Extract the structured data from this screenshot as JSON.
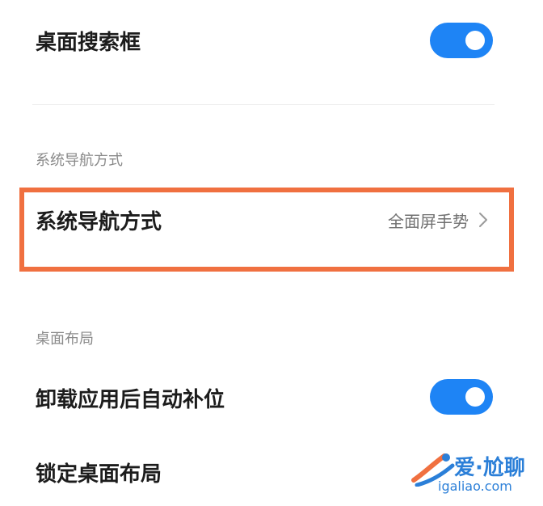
{
  "settings": {
    "search_box": {
      "label": "桌面搜索框",
      "enabled": true
    },
    "navigation_section": {
      "header": "系统导航方式",
      "row_label": "系统导航方式",
      "row_value": "全面屏手势"
    },
    "layout_section": {
      "header": "桌面布局",
      "auto_fill": {
        "label": "卸载应用后自动补位",
        "enabled": true
      },
      "lock_layout": {
        "label": "锁定桌面布局"
      }
    }
  },
  "watermark": {
    "title": "爱·尬聊",
    "url": "igaliao.com"
  },
  "colors": {
    "toggle_on": "#1e84f5",
    "highlight_border": "#f07040",
    "section_header": "#8a8a8a",
    "watermark": "#2b7fd8"
  },
  "icons": {
    "chevron": "chevron-right-icon",
    "watermark_logo": "swoosh-logo-icon"
  }
}
